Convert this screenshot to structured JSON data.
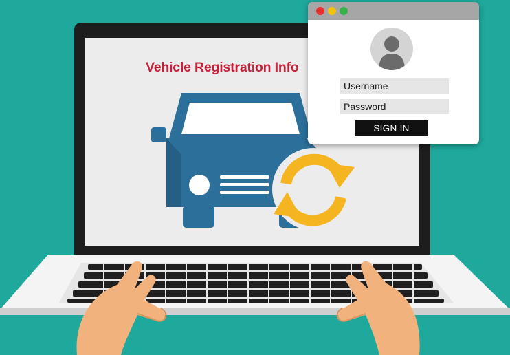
{
  "screen": {
    "title": "Vehicle Registration Info"
  },
  "login": {
    "window_controls": [
      "close",
      "minimize",
      "maximize"
    ],
    "avatar_icon": "user-icon",
    "username_placeholder": "Username",
    "password_placeholder": "Password",
    "signin_label": "SIGN IN"
  },
  "illustration": {
    "vehicle_icon": "car-icon",
    "refresh_icon": "sync-arrows-icon",
    "hands": "typing-hands"
  },
  "colors": {
    "background": "#1fa89c",
    "title": "#c4223a",
    "car": "#2b6f9a",
    "sync_arrows": "#f4b521",
    "skin": "#f2b27e"
  }
}
